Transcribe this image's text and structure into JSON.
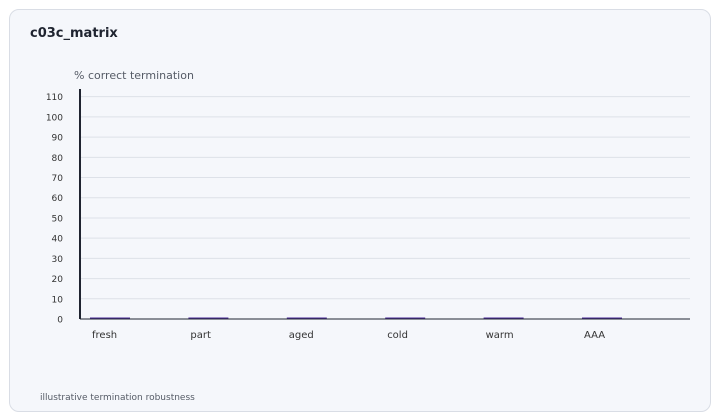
{
  "card": {
    "title": "c03c_matrix",
    "footnote": "illustrative termination robustness"
  },
  "colors": {
    "bar": "#4b2a9a",
    "axis": "#1f2430",
    "grid": "#dde1e8",
    "tick_text": "#333333",
    "label_text": "#555b66"
  },
  "chart_data": {
    "type": "bar",
    "title": "c03c_matrix",
    "ylabel": "% correct termination",
    "xlabel": "",
    "categories": [
      "fresh",
      "part",
      "aged",
      "cold",
      "warm",
      "AAA"
    ],
    "values": [
      0,
      0,
      0,
      0,
      0,
      0
    ],
    "ylim": [
      0,
      110
    ],
    "yticks": [
      0,
      10,
      20,
      30,
      40,
      50,
      60,
      70,
      80,
      90,
      100,
      110
    ],
    "grid": true,
    "legend": "none"
  }
}
